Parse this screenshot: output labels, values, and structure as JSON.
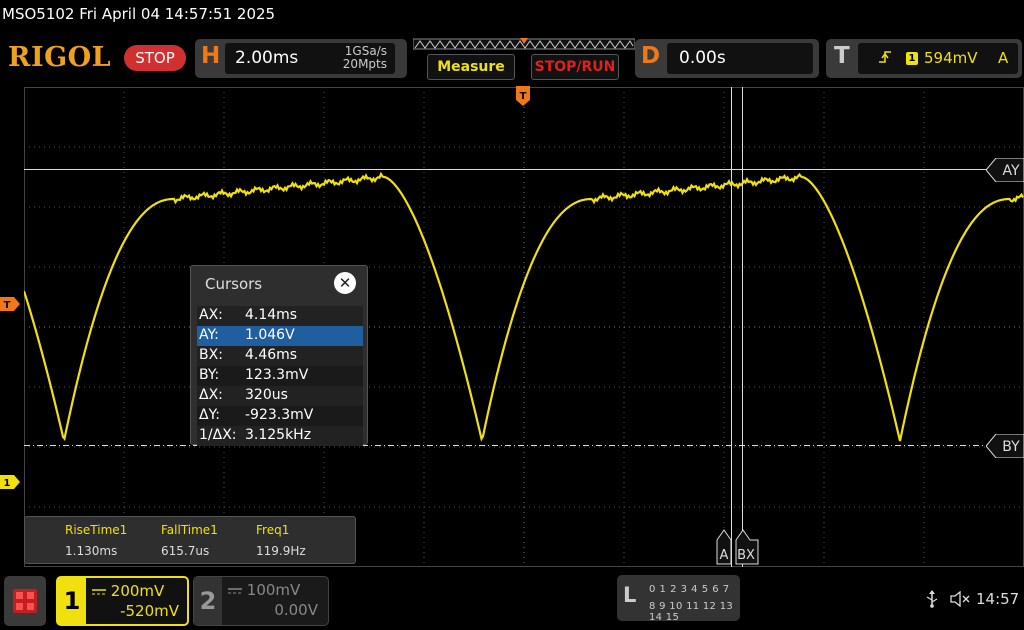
{
  "topinfo": "MSO5102  Fri April 04 14:57:51 2025",
  "brand": "RIGOL",
  "run_state": "STOP",
  "horizontal": {
    "letter": "H",
    "timebase": "2.00ms",
    "sample_rate": "1GSa/s",
    "memory_depth": "20Mpts"
  },
  "buttons": {
    "measure": "Measure",
    "stop_run": "STOP/RUN"
  },
  "delay": {
    "letter": "D",
    "value": "0.00s"
  },
  "trigger": {
    "letter": "T",
    "source": "1",
    "level": "594mV",
    "mode": "A"
  },
  "markers": {
    "trigger_pos": "T",
    "trigger_level": "T",
    "ch1_ground": "1"
  },
  "cursor_tags": {
    "ay": "AY",
    "by": "BY",
    "a": "A",
    "bx": "BX"
  },
  "cursors": {
    "title": "Cursors",
    "close": "✕",
    "rows": [
      {
        "k": "AX:",
        "v": "4.14ms"
      },
      {
        "k": "AY:",
        "v": "1.046V"
      },
      {
        "k": "BX:",
        "v": "4.46ms"
      },
      {
        "k": "BY:",
        "v": "123.3mV"
      },
      {
        "k": "ΔX:",
        "v": "320us"
      },
      {
        "k": "ΔY:",
        "v": "-923.3mV"
      },
      {
        "k": "1/ΔX:",
        "v": "3.125kHz"
      }
    ]
  },
  "measurements": [
    {
      "name": "RiseTime1",
      "value": "1.130ms"
    },
    {
      "name": "FallTime1",
      "value": "615.7us"
    },
    {
      "name": "Freq1",
      "value": "119.9Hz"
    }
  ],
  "channels": {
    "ch1": {
      "num": "1",
      "scale": "200mV",
      "offset": "-520mV",
      "color": "#f0e010"
    },
    "ch2": {
      "num": "2",
      "scale": "100mV",
      "offset": "0.00V",
      "color": "#888888"
    }
  },
  "logic": {
    "letter": "L",
    "row1": "0 1 2 3  4 5 6 7",
    "row2": "8 9 10 11 12 13 14 15"
  },
  "clock": "14:57",
  "icons": {
    "menu": "menu-grid-icon",
    "usb": "usb-icon",
    "sound": "speaker-muted-icon"
  }
}
